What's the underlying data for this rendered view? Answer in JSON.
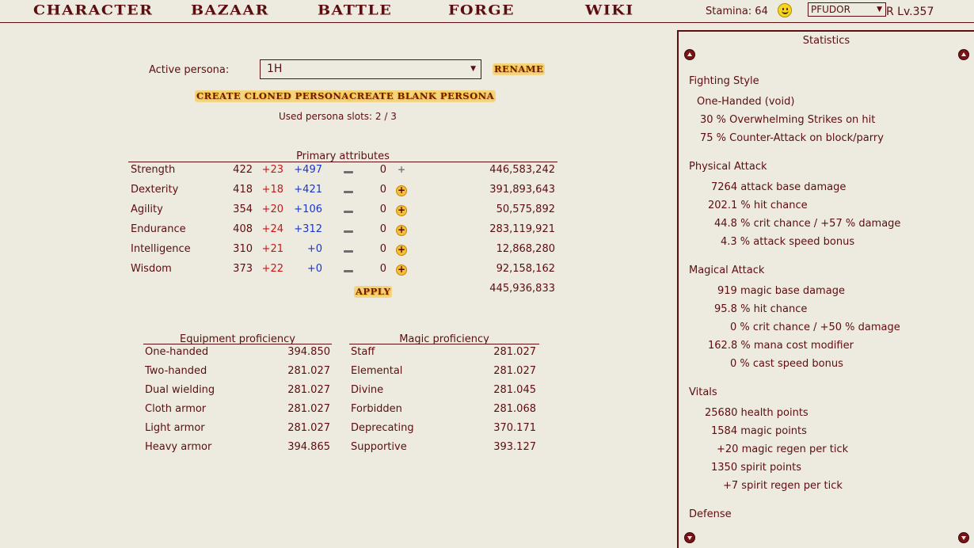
{
  "nav": {
    "items": [
      "CHARACTER",
      "BAZAAR",
      "BATTLE",
      "FORGE",
      "WIKI"
    ],
    "stamina": "Stamina: 64",
    "persona_select": "PFUDOR",
    "level": "R Lv.357"
  },
  "persona": {
    "label": "Active persona:",
    "selected": "1H",
    "rename": "RENAME",
    "create_cloned": "CREATE CLONED PERSONA",
    "create_blank": "CREATE BLANK PERSONA",
    "slots": "Used persona slots: 2 / 3"
  },
  "primary": {
    "header": "Primary attributes",
    "rows": [
      {
        "name": "Strength",
        "base": "422",
        "bonus": "+23",
        "extra": "+497",
        "assign": "0",
        "exp": "446,583,242"
      },
      {
        "name": "Dexterity",
        "base": "418",
        "bonus": "+18",
        "extra": "+421",
        "assign": "0",
        "exp": "391,893,643"
      },
      {
        "name": "Agility",
        "base": "354",
        "bonus": "+20",
        "extra": "+106",
        "assign": "0",
        "exp": "50,575,892"
      },
      {
        "name": "Endurance",
        "base": "408",
        "bonus": "+24",
        "extra": "+312",
        "assign": "0",
        "exp": "283,119,921"
      },
      {
        "name": "Intelligence",
        "base": "310",
        "bonus": "+21",
        "extra": "+0",
        "assign": "0",
        "exp": "12,868,280"
      },
      {
        "name": "Wisdom",
        "base": "373",
        "bonus": "+22",
        "extra": "+0",
        "assign": "0",
        "exp": "92,158,162"
      }
    ],
    "apply": "APPLY",
    "total_exp": "445,936,833"
  },
  "equipment": {
    "header": "Equipment proficiency",
    "rows": [
      {
        "name": "One-handed",
        "value": "394.850"
      },
      {
        "name": "Two-handed",
        "value": "281.027"
      },
      {
        "name": "Dual wielding",
        "value": "281.027"
      },
      {
        "name": "Cloth armor",
        "value": "281.027"
      },
      {
        "name": "Light armor",
        "value": "281.027"
      },
      {
        "name": "Heavy armor",
        "value": "394.865"
      }
    ]
  },
  "magic": {
    "header": "Magic proficiency",
    "rows": [
      {
        "name": "Staff",
        "value": "281.027"
      },
      {
        "name": "Elemental",
        "value": "281.027"
      },
      {
        "name": "Divine",
        "value": "281.045"
      },
      {
        "name": "Forbidden",
        "value": "281.068"
      },
      {
        "name": "Deprecating",
        "value": "370.171"
      },
      {
        "name": "Supportive",
        "value": "393.127"
      }
    ]
  },
  "stats": {
    "title": "Statistics",
    "fighting_style": "Fighting Style",
    "style_name": "One-Handed (void)",
    "style_line1": "30 % Overwhelming Strikes on hit",
    "style_line2": "75 % Counter-Attack on block/parry",
    "physical": "Physical Attack",
    "phys_dmg": "7264 attack base damage",
    "phys_hit": "202.1 % hit chance",
    "phys_crit": "44.8 % crit chance / +57 % damage",
    "phys_speed": "4.3 % attack speed bonus",
    "magical": "Magical Attack",
    "mag_dmg": "919 magic base damage",
    "mag_hit": "95.8 % hit chance",
    "mag_crit": "0 % crit chance / +50 % damage",
    "mag_cost": "162.8 % mana cost modifier",
    "mag_speed": "0 % cast speed bonus",
    "vitals": "Vitals",
    "hp": "25680 health points",
    "mp": "1584 magic points",
    "mp_regen": "+20 magic regen per tick",
    "sp": "1350 spirit points",
    "sp_regen": "+7 spirit regen per tick",
    "defense": "Defense"
  }
}
